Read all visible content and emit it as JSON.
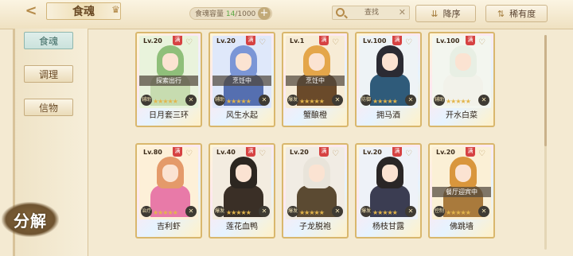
{
  "header": {
    "back_label": "<",
    "title": "食魂",
    "capacity_label": "食魂容量",
    "capacity_current": "14",
    "capacity_total": "/1000",
    "search_placeholder": "查找",
    "sort_label": "降序",
    "rarity_label": "稀有度"
  },
  "sidebar": {
    "tabs": [
      {
        "label": "食魂"
      },
      {
        "label": "调理"
      },
      {
        "label": "信物"
      }
    ],
    "decompose_label": "分解"
  },
  "max_badge": "满",
  "cards": [
    {
      "level": "Lv.20",
      "name": "日月套三环",
      "status": "探索出行",
      "role": "辅助",
      "hair": "#8fbf7a",
      "body": "#c7dcb0",
      "bg": "#e9f3dc"
    },
    {
      "level": "Lv.20",
      "name": "风生水起",
      "status": "烹饪中",
      "role": "辅助",
      "hair": "#7b96d6",
      "body": "#556fb0",
      "bg": "#dfe8fa"
    },
    {
      "level": "Lv.1",
      "name": "蟹酿橙",
      "status": "烹饪中",
      "role": "爆发",
      "hair": "#e4a64a",
      "body": "#6a4a2a",
      "bg": "#f7ecd6"
    },
    {
      "level": "Lv.100",
      "name": "拥马酒",
      "status": "",
      "role": "防御",
      "hair": "#2b2b33",
      "body": "#2f5b7a",
      "bg": "#eef3f6"
    },
    {
      "level": "Lv.100",
      "name": "开水白菜",
      "status": "",
      "role": "辅助",
      "hair": "#e8efe4",
      "body": "#f2f2ea",
      "bg": "#f3f6ef"
    },
    {
      "level": "Lv.80",
      "name": "吉利虾",
      "status": "",
      "role": "治疗",
      "hair": "#e49a6a",
      "body": "#e87aa8",
      "bg": "#fdf0d8"
    },
    {
      "level": "Lv.40",
      "name": "莲花血鸭",
      "status": "",
      "role": "爆发",
      "hair": "#2c2620",
      "body": "#3a2f26",
      "bg": "#f3ece0"
    },
    {
      "level": "Lv.20",
      "name": "子龙脱袍",
      "status": "",
      "role": "爆发",
      "hair": "#e9e4da",
      "body": "#5b4a32",
      "bg": "#f1ece4"
    },
    {
      "level": "Lv.20",
      "name": "杨枝甘露",
      "status": "",
      "role": "爆发",
      "hair": "#2a2626",
      "body": "#3b3d52",
      "bg": "#eef2f8"
    },
    {
      "level": "Lv.20",
      "name": "佛跳墙",
      "status": "餐厅迎宾中",
      "role": "控制",
      "hair": "#d9963c",
      "body": "#a97a3c",
      "bg": "#fbf0d6"
    }
  ],
  "star_count": 5
}
